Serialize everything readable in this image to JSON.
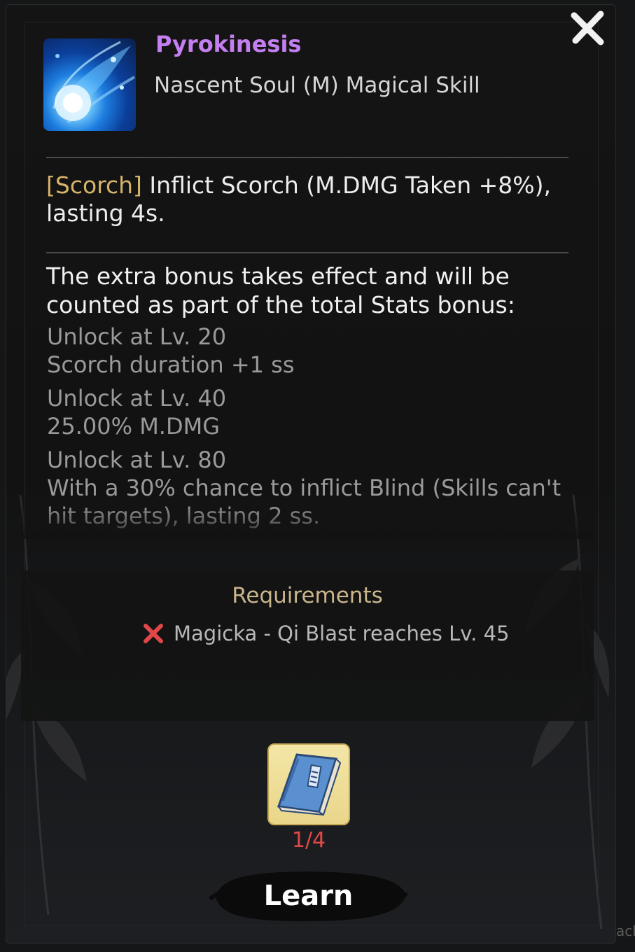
{
  "skill": {
    "name": "Pyrokinesis",
    "type": "Nascent Soul (M) Magical Skill",
    "icon": "blue-fireball-icon"
  },
  "description": {
    "tag": "[Scorch]",
    "text": " Inflict Scorch (M.DMG Taken +8%), lasting 4s."
  },
  "bonus": {
    "title": "The extra bonus takes effect and will be counted as part of the total Stats bonus:",
    "unlocks": [
      {
        "level": "Unlock at Lv. 20",
        "effect": "Scorch duration +1 ss"
      },
      {
        "level": "Unlock at Lv. 40",
        "effect": "25.00% M.DMG"
      },
      {
        "level": "Unlock at Lv. 80",
        "effect": "With a 30% chance to inflict Blind (Skills can't hit targets), lasting 2 ss."
      }
    ]
  },
  "requirements": {
    "title": "Requirements",
    "items": [
      {
        "met": false,
        "text": "Magicka - Qi Blast reaches Lv. 45"
      }
    ]
  },
  "cost": {
    "icon": "skill-book-icon",
    "count": "1/4"
  },
  "actions": {
    "learn_label": "Learn",
    "close_icon": "close-icon"
  },
  "background_edge_text": "ack",
  "colors": {
    "skill_name": "#c47ff0",
    "tag": "#d5b36a",
    "requirement_title": "#c9b58c",
    "fail_mark": "#e04848",
    "count_insufficient": "#e04848"
  }
}
